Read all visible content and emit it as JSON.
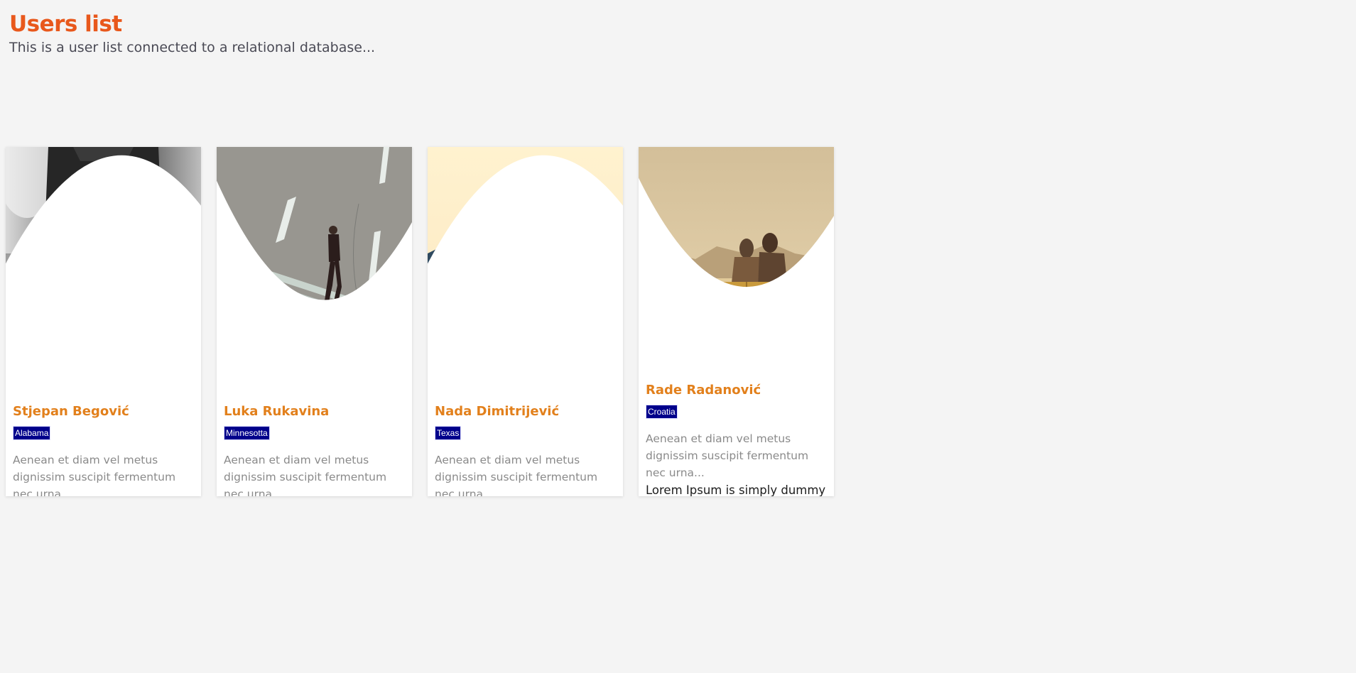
{
  "header": {
    "title": "Users list",
    "subtitle": "This is a user list connected to a relational database..."
  },
  "users": [
    {
      "name": "Stjepan Begović",
      "state": "Alabama",
      "description": "Aenean et diam vel metus dignissim suscipit fermentum nec urna...",
      "photo_icon": "man-with-camera-photo"
    },
    {
      "name": "Luka Rukavina",
      "state": "Minnesotta",
      "description": "Aenean et diam vel metus dignissim suscipit fermentum nec urna...",
      "photo_icon": "man-walking-road-photo"
    },
    {
      "name": "Nada Dimitrijević",
      "state": "Texas",
      "description": "Aenean et diam vel metus dignissim suscipit fermentum nec urna...",
      "photo_icon": "woman-sunglasses-field-photo"
    },
    {
      "name": "Rade Radanović",
      "state": "Croatia",
      "description": "Aenean et diam vel metus dignissim suscipit fermentum nec urna...",
      "extra_text": "Lorem Ipsum is simply dummy text of the printing and typesetting",
      "photo_icon": "couple-on-bench-photo"
    }
  ],
  "colors": {
    "title": "#e8581c",
    "name": "#e2801c",
    "tag_bg": "#00008b",
    "background": "#f4f4f4"
  }
}
